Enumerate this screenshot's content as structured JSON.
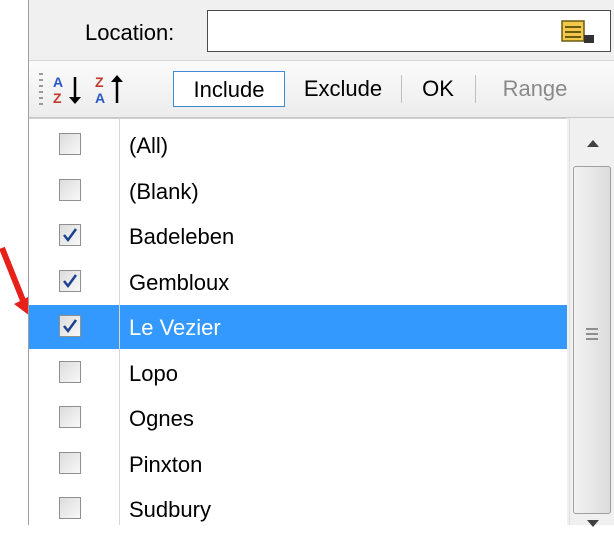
{
  "location": {
    "label": "Location:",
    "value": ""
  },
  "toolbar": {
    "sort_asc_icon": "sort-ascending-icon",
    "sort_desc_icon": "sort-descending-icon",
    "include_label": "Include",
    "exclude_label": "Exclude",
    "ok_label": "OK",
    "range_label": "Range"
  },
  "list": {
    "items": [
      {
        "label": "(All)",
        "checked": false,
        "selected": false
      },
      {
        "label": "(Blank)",
        "checked": false,
        "selected": false
      },
      {
        "label": "Badeleben",
        "checked": true,
        "selected": false
      },
      {
        "label": "Gembloux",
        "checked": true,
        "selected": false
      },
      {
        "label": "Le Vezier",
        "checked": true,
        "selected": true
      },
      {
        "label": "Lopo",
        "checked": false,
        "selected": false
      },
      {
        "label": "Ognes",
        "checked": false,
        "selected": false
      },
      {
        "label": "Pinxton",
        "checked": false,
        "selected": false
      },
      {
        "label": "Sudbury",
        "checked": false,
        "selected": false
      }
    ]
  },
  "colors": {
    "selection": "#3399ff",
    "annotation": "#e8201a",
    "active_border": "#3e8ad6"
  }
}
